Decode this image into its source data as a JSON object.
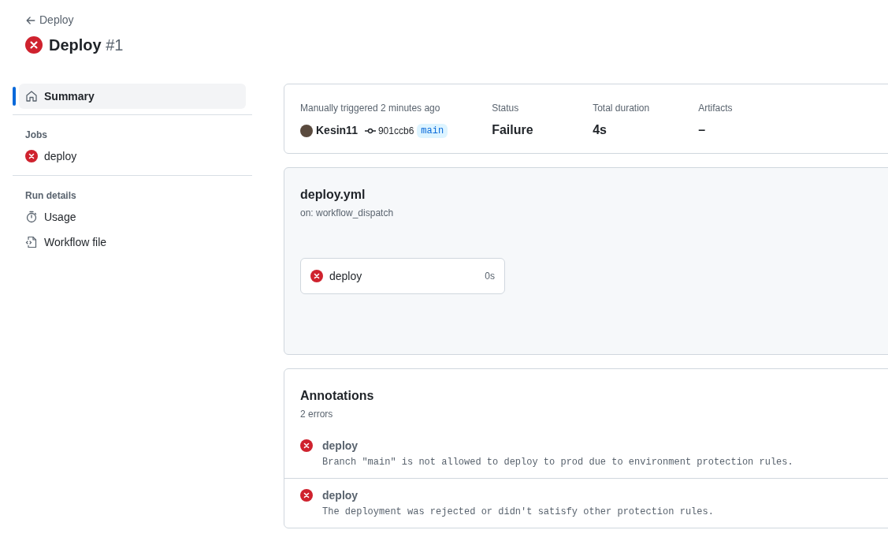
{
  "header": {
    "back_link": "Deploy",
    "title": "Deploy",
    "run_number": "#1",
    "failed": true
  },
  "sidebar": {
    "summary": {
      "label": "Summary",
      "selected": true
    },
    "jobs_heading": "Jobs",
    "jobs": [
      {
        "label": "deploy",
        "failed": true,
        "selected": false
      }
    ],
    "run_details_heading": "Run details",
    "run_details": [
      {
        "kind": "usage",
        "label": "Usage",
        "selected": false
      },
      {
        "kind": "workflow_file",
        "label": "Workflow file",
        "selected": false
      }
    ]
  },
  "summary_card": {
    "trigger": "Manually triggered 2 minutes ago",
    "actor": "Kesin11",
    "commit": "901ccb6",
    "branch": "main",
    "stats": [
      {
        "label": "Status",
        "value": "Failure"
      },
      {
        "label": "Total duration",
        "value": "4s"
      },
      {
        "label": "Artifacts",
        "value": "–"
      }
    ]
  },
  "workflow_card": {
    "file": "deploy.yml",
    "trigger": "on: workflow_dispatch",
    "jobs": [
      {
        "name": "deploy",
        "failed": true,
        "duration": "0s"
      }
    ]
  },
  "annotations": {
    "title": "Annotations",
    "count": "2 errors",
    "items": [
      {
        "error": true,
        "job": "deploy",
        "message": "Branch \"main\" is not allowed to deploy to prod due to environment protection rules."
      },
      {
        "error": true,
        "job": "deploy",
        "message": "The deployment was rejected or didn't satisfy other protection rules."
      }
    ]
  }
}
